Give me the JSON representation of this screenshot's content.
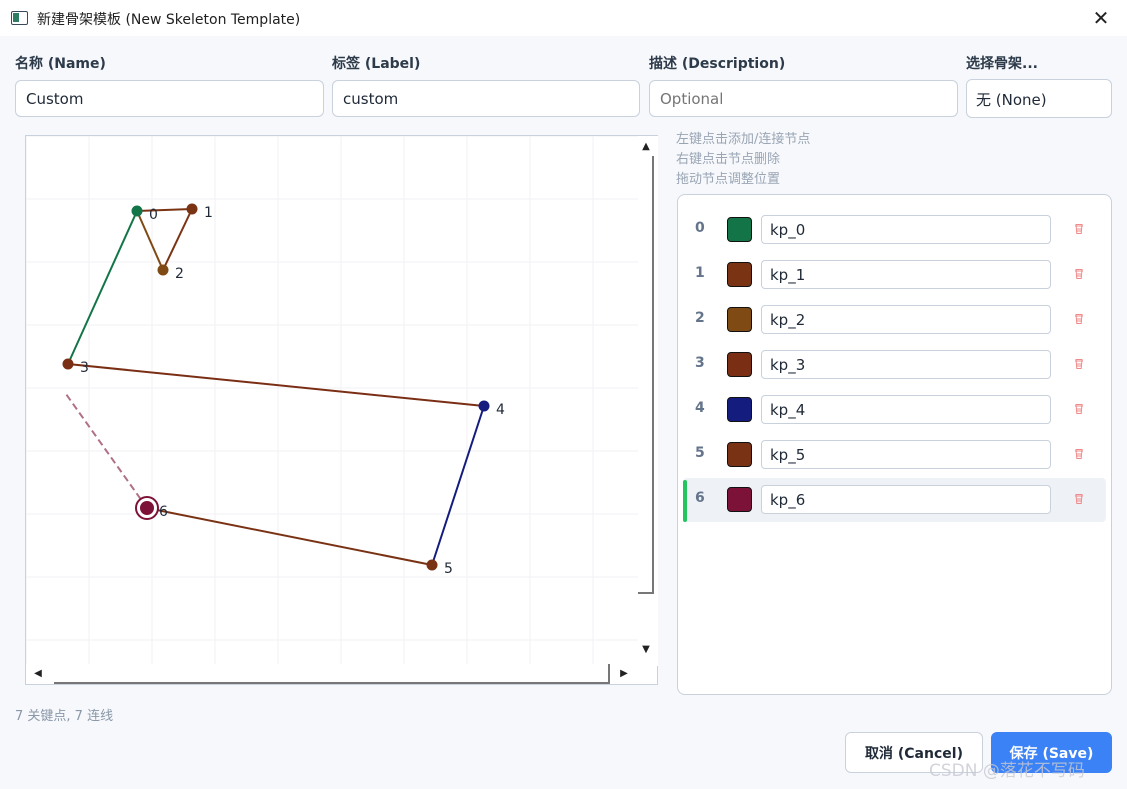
{
  "window": {
    "title": "新建骨架模板 (New Skeleton Template)",
    "close_icon": "close-icon"
  },
  "form": {
    "name_label": "名称 (Name)",
    "name_value": "Custom",
    "label_label": "标签 (Label)",
    "label_value": "custom",
    "description_label": "描述 (Description)",
    "description_placeholder": "Optional",
    "skeleton_label": "选择骨架...",
    "skeleton_value": "无 (None)"
  },
  "hints": [
    "左键点击添加/连接节点",
    "右键点击节点删除",
    "拖动节点调整位置"
  ],
  "keypoints": [
    {
      "index": "0",
      "name": "kp_0",
      "color": "#137547"
    },
    {
      "index": "1",
      "name": "kp_1",
      "color": "#7a3413"
    },
    {
      "index": "2",
      "name": "kp_2",
      "color": "#7f4a14"
    },
    {
      "index": "3",
      "name": "kp_3",
      "color": "#7a2e14"
    },
    {
      "index": "4",
      "name": "kp_4",
      "color": "#141c7d"
    },
    {
      "index": "5",
      "name": "kp_5",
      "color": "#7a3214"
    },
    {
      "index": "6",
      "name": "kp_6",
      "color": "#7d1238"
    }
  ],
  "selected_keypoint": "6",
  "edges": [
    {
      "from": "0",
      "to": "1",
      "color": "#7a3413"
    },
    {
      "from": "0",
      "to": "2",
      "color": "#7f4a14"
    },
    {
      "from": "1",
      "to": "2",
      "color": "#7a3413"
    },
    {
      "from": "0",
      "to": "3",
      "color": "#137547"
    },
    {
      "from": "3",
      "to": "4",
      "color": "#7a2e14"
    },
    {
      "from": "4",
      "to": "5",
      "color": "#141c7d"
    },
    {
      "from": "5",
      "to": "6",
      "color": "#7a3214"
    }
  ],
  "pending_connection": {
    "from": "6",
    "color": "#b07088"
  },
  "summary": "7 关键点, 7 连线",
  "buttons": {
    "cancel": "取消 (Cancel)",
    "save": "保存 (Save)"
  },
  "watermark": "CSDN @落花不写码"
}
